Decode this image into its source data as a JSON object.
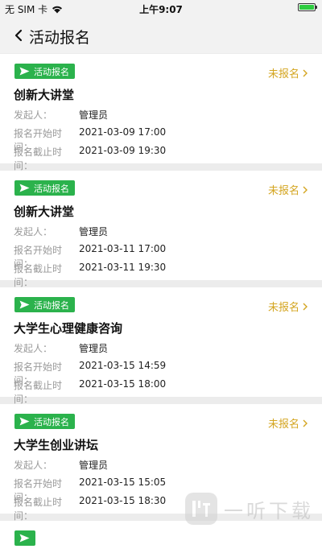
{
  "status_bar": {
    "carrier": "无 SIM 卡",
    "time": "上午9:07"
  },
  "nav": {
    "title": "活动报名"
  },
  "colors": {
    "tag_green": "#2bb24c",
    "status_gold": "#d4a520",
    "label_gray": "#9a9a9a"
  },
  "cards": [
    {
      "tag": "活动报名",
      "status": "未报名",
      "title": "创新大讲堂",
      "organizer_label": "发起人：",
      "organizer": "管理员",
      "start_label": "报名开始时间：",
      "start": "2021-03-09 17:00",
      "end_label": "报名截止时间：",
      "end": "2021-03-09 19:30"
    },
    {
      "tag": "活动报名",
      "status": "未报名",
      "title": "创新大讲堂",
      "organizer_label": "发起人：",
      "organizer": "管理员",
      "start_label": "报名开始时间：",
      "start": "2021-03-11 17:00",
      "end_label": "报名截止时间：",
      "end": "2021-03-11 19:30"
    },
    {
      "tag": "活动报名",
      "status": "未报名",
      "title": "大学生心理健康咨询",
      "organizer_label": "发起人：",
      "organizer": "管理员",
      "start_label": "报名开始时间：",
      "start": "2021-03-15 14:59",
      "end_label": "报名截止时间：",
      "end": "2021-03-15 18:00"
    },
    {
      "tag": "活动报名",
      "status": "未报名",
      "title": "大学生创业讲坛",
      "organizer_label": "发起人：",
      "organizer": "管理员",
      "start_label": "报名开始时间：",
      "start": "2021-03-15 15:05",
      "end_label": "报名截止时间：",
      "end": "2021-03-15 18:30"
    }
  ],
  "watermark": {
    "text": "一听下载"
  }
}
